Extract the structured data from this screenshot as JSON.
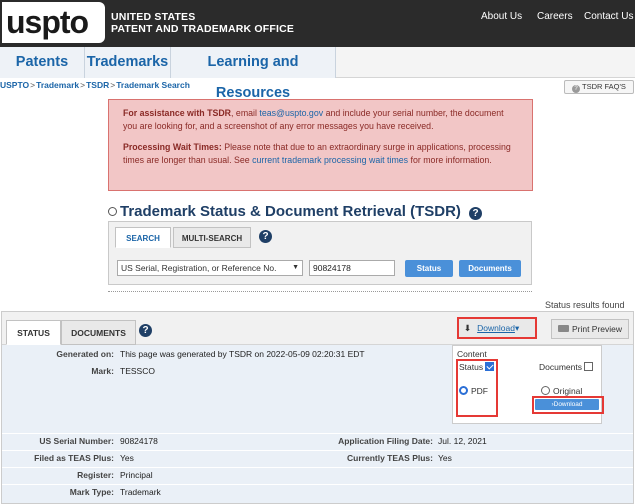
{
  "header": {
    "logo_text": "uspto",
    "agency_line1": "UNITED STATES",
    "agency_line2": "PATENT AND TRADEMARK OFFICE",
    "links": [
      "About Us",
      "Careers",
      "Contact Us"
    ]
  },
  "nav": {
    "tabs": [
      "Patents",
      "Trademarks",
      "Learning and Resources"
    ]
  },
  "breadcrumb": {
    "items": [
      "USPTO",
      "Trademark",
      "TSDR",
      "Trademark Search"
    ],
    "sep": ">"
  },
  "faq_button": {
    "icon": "?",
    "label": "TSDR FAQ'S"
  },
  "notice": {
    "p1_bold": "For assistance with TSDR",
    "p1_a": ", email ",
    "p1_email": "teas@uspto.gov",
    "p1_b": " and include your serial number, the document you are looking for, and a screenshot of any error messages you have received.",
    "p2_bold": "Processing Wait Times:",
    "p2_a": " Please note that due to an extraordinary surge in applications, processing times are longer than usual. See ",
    "p2_link": "current trademark processing wait times",
    "p2_b": " for more information."
  },
  "tsdr_title": "Trademark Status & Document Retrieval (TSDR)",
  "help_glyph": "?",
  "search": {
    "tabs": [
      "SEARCH",
      "MULTI-SEARCH"
    ],
    "select_value": "US Serial, Registration, or Reference No.",
    "select_caret": "▼",
    "input_value": "90824178",
    "buttons": [
      "Status",
      "Documents"
    ]
  },
  "results_text": "Status results found",
  "panel": {
    "tabs": [
      "STATUS",
      "DOCUMENTS"
    ],
    "download_arrow": "⬇",
    "download_label": "Download",
    "download_caret": "▾",
    "print_label": "Print Preview",
    "fields": {
      "generated_label": "Generated on:",
      "generated_value": "This page was generated by TSDR on 2022-05-09 02:20:31 EDT",
      "mark_label": "Mark:",
      "mark_value": "TESSCO",
      "serial_label": "US Serial Number:",
      "serial_value": "90824178",
      "filing_label": "Application Filing Date:",
      "filing_value": "Jul. 12, 2021",
      "teas_label": "Filed as TEAS Plus:",
      "teas_value": "Yes",
      "current_teas_label": "Currently TEAS Plus:",
      "current_teas_value": "Yes",
      "register_label": "Register:",
      "register_value": "Principal",
      "marktype_label": "Mark Type:",
      "marktype_value": "Trademark"
    },
    "dropdown": {
      "title": "Content",
      "status_label": "Status",
      "status_checked": true,
      "documents_label": "Documents",
      "documents_checked": false,
      "pdf_label": "PDF",
      "original_label": "Original",
      "download_button": "Download",
      "download_arrow": "›"
    }
  },
  "colors": {
    "header_bg": "#2b2b2b",
    "link_blue": "#1b65a8",
    "title_navy": "#1f3f66",
    "notice_bg": "#f2c6c6",
    "notice_border": "#d9726f",
    "button_blue": "#4a90d9",
    "highlight_red": "#e53935"
  }
}
